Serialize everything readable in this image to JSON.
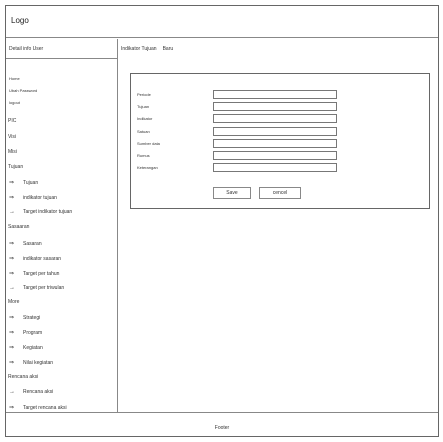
{
  "header": {
    "logo": "Logo"
  },
  "sidebar": {
    "user_title": "Detail info User",
    "account_links": [
      "Home",
      "Ubah Password",
      "logout"
    ],
    "pic": "PIC",
    "visi": "Visi",
    "misi": "Misi",
    "tujuan_group": "Tujuan",
    "tujuan_items": [
      "Tujuan",
      "indikator tujuan",
      "Target indikator tujuan"
    ],
    "sasaran_group": "Sasaaran",
    "sasaran_items": [
      "Sasaran",
      "indikator sasaran",
      "Target per tahun",
      "Target per triwulan"
    ],
    "more_group": "More",
    "more_items": [
      "Strategi",
      "Program",
      "Kegiatan",
      "Nilai kegiatan"
    ],
    "rencana_group": "Rencana aksi",
    "rencana_items": [
      "Rencana aksi",
      "Target rencana aksi"
    ]
  },
  "main": {
    "breadcrumb_section": "Indikator Tujuan",
    "breadcrumb_action": "Baru",
    "form": {
      "labels": [
        "Periode",
        "Tujuan",
        "Indikator",
        "Satuan",
        "Sumber data",
        "Rumus",
        "Keterangan"
      ],
      "values": [
        "",
        "",
        "",
        "",
        "",
        "",
        ""
      ],
      "save_label": "Save",
      "cancel_label": "cencel"
    }
  },
  "footer": {
    "text": "Footer"
  }
}
